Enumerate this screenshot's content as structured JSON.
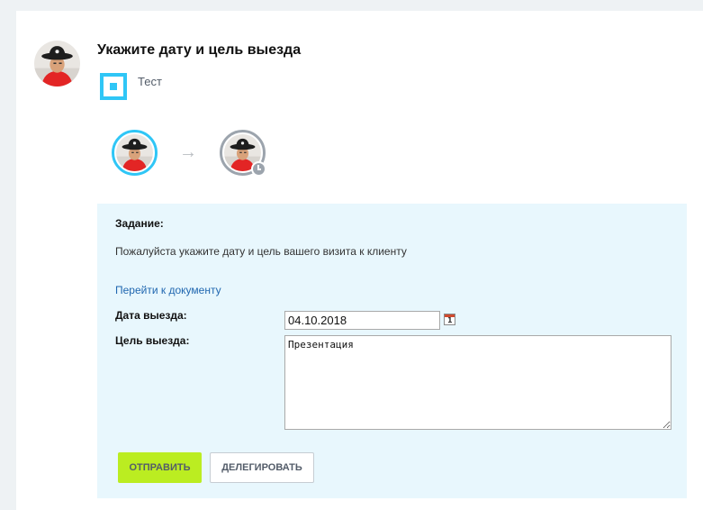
{
  "task": {
    "title": "Укажите дату и цель выезда",
    "entity": "Тест",
    "section_label": "Задание:",
    "description": "Пожалуйста укажите дату и цель вашего визита к клиенту",
    "document_link": "Перейти к документу",
    "date_label": "Дата выезда:",
    "date_value": "04.10.2018",
    "goal_label": "Цель выезда:",
    "goal_value": "Презентация"
  },
  "actions": {
    "send": "ОТПРАВИТЬ",
    "delegate": "ДЕЛЕГИРОВАТЬ"
  },
  "icons": {
    "crm": "crm-entity-icon",
    "calendar": "calendar-icon",
    "arrow": "arrow-right-icon",
    "clock": "clock-icon"
  },
  "colors": {
    "accent": "#2fc6f6",
    "send_button": "#bbed21",
    "task_background": "#e8f7fd",
    "link": "#2067b0"
  }
}
